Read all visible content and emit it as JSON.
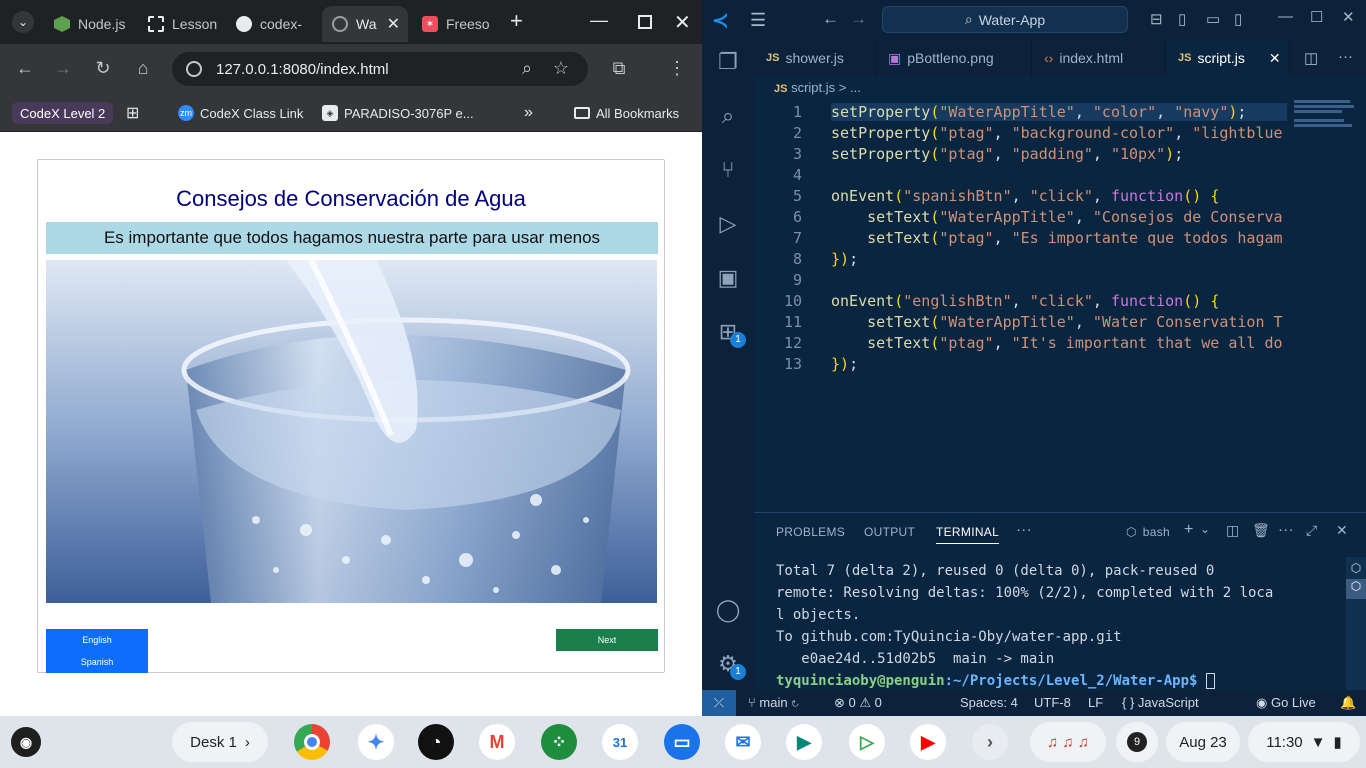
{
  "chrome": {
    "tabs": [
      {
        "label": "Node.js",
        "active": false
      },
      {
        "label": "Lesson",
        "active": false
      },
      {
        "label": "codex-",
        "active": false
      },
      {
        "label": "Wa",
        "active": true
      },
      {
        "label": "Freeso",
        "active": false
      }
    ],
    "new_tab": "+",
    "url": "127.0.0.1:8080/index.html",
    "bookmarks": {
      "group": "CodeX Level 2",
      "items": [
        "CodeX Class Link",
        "PARADISO-3076P e..."
      ],
      "more": "»",
      "all": "All Bookmarks"
    }
  },
  "app": {
    "title": "Consejos de Conservación de Agua",
    "ptag": "Es importante que todos hagamos nuestra parte para usar menos",
    "english_btn": "English",
    "spanish_btn": "Spanish",
    "next_btn": "Next"
  },
  "vscode": {
    "search": "Water-App",
    "tabs": [
      {
        "label": "shower.js",
        "kind": "js"
      },
      {
        "label": "pBottleno.png",
        "kind": "img"
      },
      {
        "label": "index.html",
        "kind": "html"
      },
      {
        "label": "script.js",
        "kind": "js",
        "active": true
      }
    ],
    "breadcrumb": "script.js > ...",
    "code_lines": [
      "setProperty(\"WaterAppTitle\", \"color\", \"navy\");",
      "setProperty(\"ptag\", \"background-color\", \"lightblue",
      "setProperty(\"ptag\", \"padding\", \"10px\");",
      "",
      "onEvent(\"spanishBtn\", \"click\", function() {",
      "    setText(\"WaterAppTitle\", \"Consejos de Conserva",
      "    setText(\"ptag\", \"Es importante que todos hagam",
      "});",
      "",
      "onEvent(\"englishBtn\", \"click\", function() {",
      "    setText(\"WaterAppTitle\", \"Water Conservation T",
      "    setText(\"ptag\", \"It's important that we all do",
      "});"
    ],
    "panel_tabs": [
      "PROBLEMS",
      "OUTPUT",
      "TERMINAL"
    ],
    "terminal_shell": "bash",
    "terminal_lines": [
      "Total 7 (delta 2), reused 0 (delta 0), pack-reused 0",
      "remote: Resolving deltas: 100% (2/2), completed with 2 loca",
      "l objects.",
      "To github.com:TyQuincia-Oby/water-app.git",
      "   e0ae24d..51d02b5  main -> main"
    ],
    "prompt_user": "tyquinciaoby@penguin",
    "prompt_path": ":~/Projects/Level_2/Water-App$",
    "status": {
      "branch": "main",
      "errors": "0",
      "warnings": "0",
      "spaces": "Spaces: 4",
      "encoding": "UTF-8",
      "eol": "LF",
      "language": "JavaScript",
      "golive": "Go Live"
    },
    "badge": "1"
  },
  "shelf": {
    "desk": "Desk 1",
    "notifications": "9",
    "date": "Aug 23",
    "time": "11:30"
  },
  "colors": {
    "title_navy": "#000080",
    "ptag_bg": "#add8e6",
    "btn_blue": "#0d6efd",
    "btn_green": "#1b7f4d",
    "vscode_bg": "#0a2540"
  }
}
